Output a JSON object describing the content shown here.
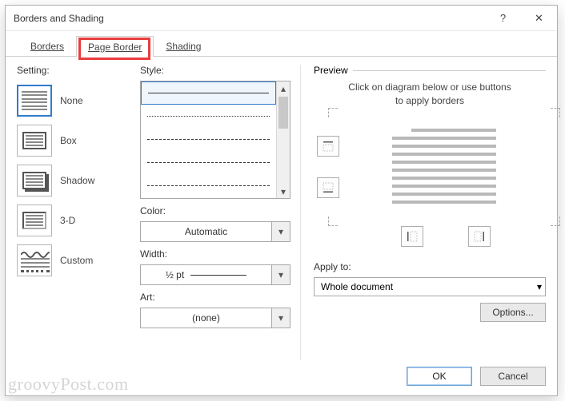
{
  "title": "Borders and Shading",
  "win": {
    "help": "?",
    "close": "✕"
  },
  "tabs": {
    "borders": "Borders",
    "page_border": "Page Border",
    "shading": "Shading"
  },
  "setting": {
    "label": "Setting:",
    "items": [
      "None",
      "Box",
      "Shadow",
      "3-D",
      "Custom"
    ]
  },
  "style": {
    "label": "Style:",
    "color_label": "Color:",
    "color_value": "Automatic",
    "width_label": "Width:",
    "width_value": "½ pt",
    "art_label": "Art:",
    "art_value": "(none)"
  },
  "preview": {
    "label": "Preview",
    "hint1": "Click on diagram below or use buttons",
    "hint2": "to apply borders",
    "apply_label": "Apply to:",
    "apply_value": "Whole document",
    "options": "Options..."
  },
  "buttons": {
    "ok": "OK",
    "cancel": "Cancel"
  },
  "watermark": "groovyPost.com"
}
